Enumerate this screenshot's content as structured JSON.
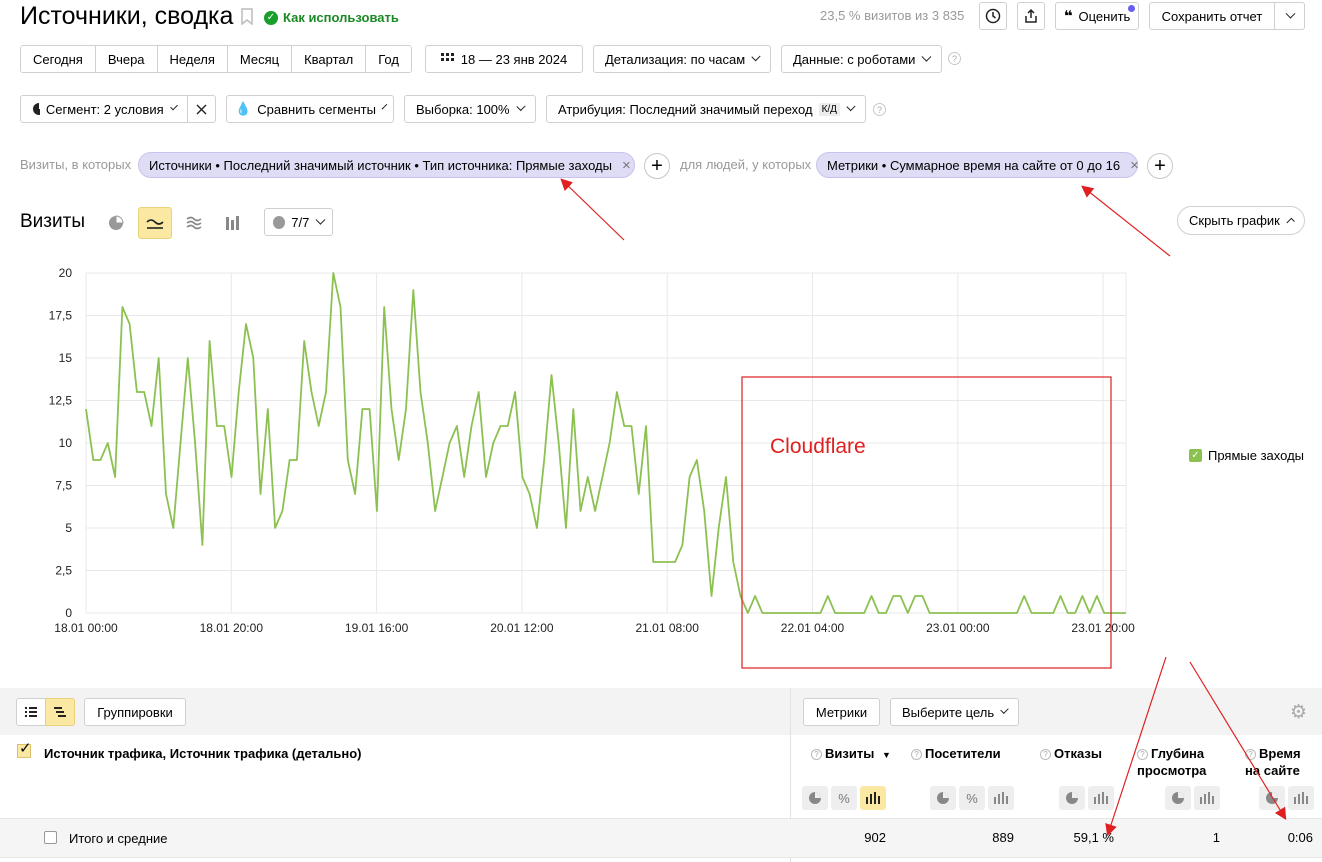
{
  "header": {
    "title": "Источники, сводка",
    "how_to_use": "Как использовать",
    "visits_info": "23,5 % визитов из 3 835",
    "rate_label": "Оценить",
    "save_report": "Сохранить отчет"
  },
  "periods": [
    "Сегодня",
    "Вчера",
    "Неделя",
    "Месяц",
    "Квартал",
    "Год"
  ],
  "date_range": "18 — 23 янв 2024",
  "detail_label": "Детализация: по часам",
  "data_label": "Данные: с роботами",
  "segment_label": "Сегмент: 2 условия",
  "compare_label": "Сравнить сегменты",
  "sample_label": "Выборка: 100%",
  "attribution_label": "Атрибуция: Последний значимый переход",
  "attribution_badge": "К/Д",
  "filters": {
    "visits_prefix": "Визиты, в которых",
    "visits_chip": "Источники • Последний значимый источник • Тип источника: Прямые заходы",
    "people_prefix": "для людей, у которых",
    "people_chip": "Метрики • Суммарное время на сайте от 0 до 16"
  },
  "chart_section": {
    "title": "Визиты",
    "series_count": "7/7",
    "hide_chart": "Скрыть график",
    "annotation": "Cloudflare"
  },
  "chart_data": {
    "type": "line",
    "ylim": [
      0,
      20
    ],
    "yticks": [
      "0",
      "2,5",
      "5",
      "7,5",
      "10",
      "12,5",
      "15",
      "17,5",
      "20"
    ],
    "xticks": [
      "18.01 00:00",
      "18.01 20:00",
      "19.01 16:00",
      "20.01 12:00",
      "21.01 08:00",
      "22.01 04:00",
      "23.01 00:00",
      "23.01 20:00"
    ],
    "series": [
      {
        "name": "Прямые заходы",
        "color": "#8cc152",
        "values": [
          12,
          9,
          9,
          10,
          8,
          18,
          17,
          13,
          13,
          11,
          15,
          7,
          5,
          10,
          15,
          10,
          4,
          16,
          11,
          11,
          8,
          13,
          17,
          15,
          7,
          12,
          5,
          6,
          9,
          9,
          16,
          13,
          11,
          13,
          20,
          18,
          9,
          7,
          12,
          12,
          6,
          18,
          12,
          9,
          12,
          19,
          13,
          10,
          6,
          8,
          10,
          11,
          8,
          11,
          13,
          8,
          10,
          11,
          11,
          13,
          8,
          7,
          5,
          9,
          14,
          10,
          5,
          12,
          6,
          8,
          6,
          8,
          10,
          13,
          11,
          11,
          7,
          11,
          3,
          3,
          3,
          3,
          4,
          8,
          9,
          6,
          1,
          5,
          8,
          3,
          1,
          0,
          1,
          0,
          0,
          0,
          0,
          0,
          0,
          0,
          0,
          0,
          1,
          0,
          0,
          0,
          0,
          0,
          1,
          0,
          0,
          1,
          1,
          0,
          1,
          1,
          0,
          0,
          0,
          0,
          0,
          0,
          0,
          0,
          0,
          0,
          0,
          0,
          0,
          1,
          0,
          0,
          0,
          0,
          1,
          0,
          0,
          1,
          0,
          1,
          0,
          0,
          0,
          0
        ]
      }
    ],
    "legend_position": "right"
  },
  "table": {
    "groupings": "Группировки",
    "metrics": "Метрики",
    "choose_goal": "Выберите цель",
    "dimension_header": "Источник трафика, Источник трафика (детально)",
    "columns": [
      {
        "line1": "Визиты",
        "line2": ""
      },
      {
        "line1": "Посетители",
        "line2": ""
      },
      {
        "line1": "Отказы",
        "line2": ""
      },
      {
        "line1": "Глубина",
        "line2": "просмотра"
      },
      {
        "line1": "Время",
        "line2": "на сайте"
      }
    ],
    "totals_label": "Итого и средние",
    "totals": [
      "902",
      "889",
      "59,1 %",
      "1",
      "0:06"
    ]
  }
}
